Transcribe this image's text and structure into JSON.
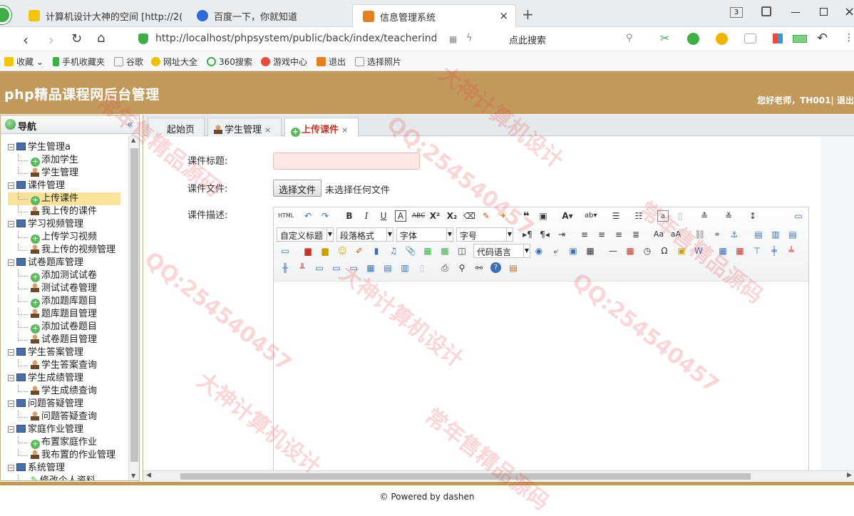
{
  "browser": {
    "tabs": [
      {
        "label": "计算机设计大神的空间 [http://2(",
        "active": false
      },
      {
        "label": "百度一下，你就知道",
        "active": false
      },
      {
        "label": "信息管理系统",
        "active": true
      }
    ],
    "new_tab": "+",
    "tab_count": "3",
    "address": "http://localhost/phpsystem/public/back/index/teacherind(",
    "search_placeholder": "点此搜索",
    "bookmarks": [
      "收藏",
      "手机收藏夹",
      "谷歌",
      "网址大全",
      "360搜索",
      "游戏中心",
      "退出",
      "选择照片"
    ]
  },
  "app": {
    "title": "php精品课程网后台管理",
    "greeting": "您好老师，TH001| 退出"
  },
  "sidebar": {
    "title": "导航",
    "collapse": "«",
    "tree": [
      {
        "label": "学生管理a",
        "children": [
          "添加学生",
          "学生管理"
        ]
      },
      {
        "label": "课件管理",
        "children": [
          "上传课件",
          "我上传的课件"
        ]
      },
      {
        "label": "学习视频管理",
        "children": [
          "上传学习视频",
          "我上传的视频管理"
        ]
      },
      {
        "label": "试卷题库管理",
        "children": [
          "添加测试试卷",
          "测试试卷管理",
          "添加题库题目",
          "题库题目管理",
          "添加试卷题目",
          "试卷题目管理"
        ]
      },
      {
        "label": "学生答案管理",
        "children": [
          "学生答案查询"
        ]
      },
      {
        "label": "学生成绩管理",
        "children": [
          "学生成绩查询"
        ]
      },
      {
        "label": "问题答疑管理",
        "children": [
          "问题答疑查询"
        ]
      },
      {
        "label": "家庭作业管理",
        "children": [
          "布置家庭作业",
          "我布置的作业管理"
        ]
      },
      {
        "label": "系统管理",
        "children": [
          "修改个人资料"
        ]
      }
    ],
    "selected": "上传课件"
  },
  "tabs": [
    {
      "label": "起始页",
      "closable": false
    },
    {
      "label": "学生管理",
      "closable": true
    },
    {
      "label": "上传课件",
      "closable": true,
      "active": true
    }
  ],
  "form": {
    "title_label": "课件标题:",
    "title_value": "",
    "file_label": "课件文件:",
    "file_button": "选择文件",
    "file_status": "未选择任何文件",
    "desc_label": "课件描述:"
  },
  "editor": {
    "combos": [
      "自定义标题",
      "段落格式",
      "字体",
      "字号",
      "代码语言"
    ]
  },
  "footer": "© Powered by dashen",
  "colors": {
    "header_bg": "#c19a5b",
    "selected_node": "#fbe29a",
    "title_input_bg": "#fde8e6"
  },
  "watermark": {
    "lines": [
      "QQ:254540457",
      "大神计算机设计",
      "常年售精品源码"
    ]
  }
}
